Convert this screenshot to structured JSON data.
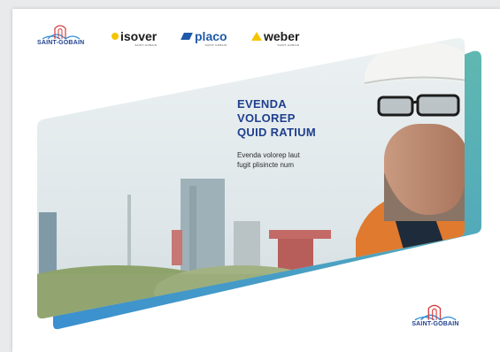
{
  "brands": {
    "saint_gobain": "SAINT-GOBAIN",
    "isover": "isover",
    "placo": "placo",
    "weber": "weber",
    "partner_sub": "SAINT-GOBAIN"
  },
  "hero": {
    "title_lines": [
      "EVENDA",
      "VOLOREP",
      "QUID RATIUM"
    ],
    "subtitle_lines": [
      "Evenda volorep laut",
      "fugit plisincte num"
    ]
  },
  "colors": {
    "brand_blue": "#1f3f8e",
    "accent_teal": "#5fb8b0",
    "accent_blue": "#3a8fd0",
    "isover_yellow": "#f5c400",
    "placo_blue": "#1f5aa8"
  },
  "icons": {
    "sg_logo": "saint-gobain-arch-icon",
    "isover_logo": "isover-dot-icon",
    "placo_logo": "placo-parallelogram-icon",
    "weber_logo": "weber-triangle-icon"
  }
}
